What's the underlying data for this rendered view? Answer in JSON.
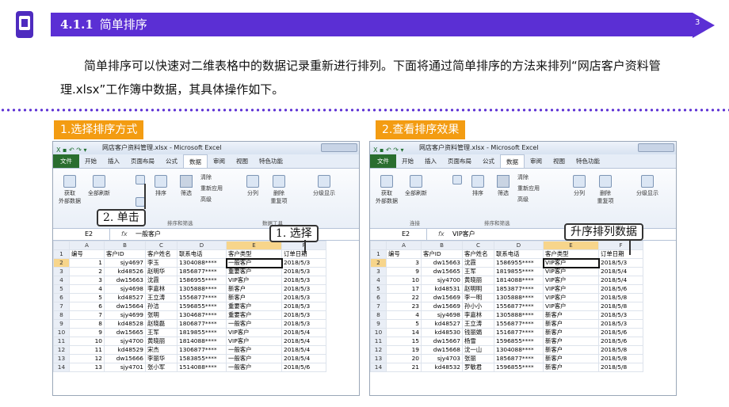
{
  "header": {
    "section_number": "4.1.1",
    "section_title": "简单排序",
    "page_number": "3"
  },
  "intro": "简单排序可以快速对二维表格中的数据记录重新进行排列。下面将通过简单排序的方法来排列“网店客户资料管理.xlsx”工作簿中数据，其具体操作如下。",
  "left": {
    "step_label": "1.选择排序方式",
    "title": "网店客户资料管理.xlsx - Microsoft Excel",
    "tabs": [
      "文件",
      "开始",
      "插入",
      "页面布局",
      "公式",
      "数据",
      "审阅",
      "视图",
      "特色功能"
    ],
    "active_tab": "数据",
    "ribbon": {
      "get_external": "获取\n外部数据",
      "refresh_all": "全部刷新",
      "sort": "排序",
      "filter": "筛选",
      "clear": "清除",
      "reapply": "重新应用",
      "advanced": "高级",
      "split": "分列",
      "remove_dup": "删除\n重复项",
      "outline": "分级显示",
      "group_sort": "排序和筛选",
      "group_tools": "数据工具"
    },
    "namebox": "E2",
    "formula": "一般客户",
    "col_headers": [
      "A",
      "B",
      "C",
      "D",
      "E",
      "F"
    ],
    "rows": [
      [
        "1",
        "编号",
        "客户ID",
        "客户姓名",
        "联系电话",
        "客户类型",
        "订单日期"
      ],
      [
        "2",
        "1",
        "sjy4697",
        "李玉",
        "1304088****",
        "一般客户",
        "2018/5/3"
      ],
      [
        "3",
        "2",
        "kd48526",
        "赵明华",
        "1856877****",
        "重要客户",
        "2018/5/3"
      ],
      [
        "4",
        "3",
        "dw15663",
        "沈霞",
        "1586955****",
        "VIP客户",
        "2018/5/3"
      ],
      [
        "5",
        "4",
        "sjy4698",
        "李嘉林",
        "1305888****",
        "新客户",
        "2018/5/3"
      ],
      [
        "6",
        "5",
        "kd48527",
        "王立涛",
        "1556877****",
        "新客户",
        "2018/5/3"
      ],
      [
        "7",
        "6",
        "dw15664",
        "孙洁",
        "1596855****",
        "重要客户",
        "2018/5/3"
      ],
      [
        "8",
        "7",
        "sjy4699",
        "张明",
        "1304687****",
        "重要客户",
        "2018/5/3"
      ],
      [
        "9",
        "8",
        "kd48528",
        "赵晓磊",
        "1806877****",
        "一般客户",
        "2018/5/3"
      ],
      [
        "10",
        "9",
        "dw15665",
        "王军",
        "1819855****",
        "VIP客户",
        "2018/5/4"
      ],
      [
        "11",
        "10",
        "sjy4700",
        "黄晓丽",
        "1814088****",
        "VIP客户",
        "2018/5/4"
      ],
      [
        "12",
        "11",
        "kd48529",
        "宋杰",
        "1306877****",
        "一般客户",
        "2018/5/4"
      ],
      [
        "13",
        "12",
        "dw15666",
        "李丽华",
        "1583855****",
        "一般客户",
        "2018/5/4"
      ],
      [
        "14",
        "13",
        "sjy4701",
        "张小军",
        "1514088****",
        "一般客户",
        "2018/5/6"
      ]
    ],
    "callouts": {
      "click": "2. 单击",
      "select": "1. 选择"
    }
  },
  "right": {
    "step_label": "2.查看排序效果",
    "title": "网店客户资料管理.xlsx - Microsoft Excel",
    "tabs": [
      "文件",
      "开始",
      "插入",
      "页面布局",
      "公式",
      "数据",
      "审阅",
      "视图",
      "特色功能"
    ],
    "active_tab": "数据",
    "ribbon": {
      "get_external": "获取\n外部数据",
      "refresh_all": "全部刷新",
      "sort": "排序",
      "filter": "筛选",
      "clear": "清除",
      "reapply": "重新应用",
      "advanced": "高级",
      "split": "分列",
      "remove_dup": "删除\n重复项",
      "outline": "分级显示",
      "group_conn": "连接",
      "group_sort": "排序和筛选"
    },
    "namebox": "E2",
    "formula": "VIP客户",
    "col_headers": [
      "A",
      "B",
      "C",
      "D",
      "E",
      "F"
    ],
    "rows": [
      [
        "1",
        "编号",
        "客户ID",
        "客户姓名",
        "联系电话",
        "客户类型",
        "订单日期"
      ],
      [
        "2",
        "3",
        "dw15663",
        "沈霞",
        "1586955****",
        "VIP客户",
        "2018/5/3"
      ],
      [
        "3",
        "9",
        "dw15665",
        "王军",
        "1819855****",
        "VIP客户",
        "2018/5/4"
      ],
      [
        "4",
        "10",
        "sjy4700",
        "黄晓丽",
        "1814088****",
        "VIP客户",
        "2018/5/4"
      ],
      [
        "5",
        "17",
        "kd48531",
        "赵明明",
        "1853877****",
        "VIP客户",
        "2018/5/6"
      ],
      [
        "6",
        "22",
        "dw15669",
        "李一明",
        "1305888****",
        "VIP客户",
        "2018/5/8"
      ],
      [
        "7",
        "23",
        "dw15669",
        "孙小小",
        "1556877****",
        "VIP客户",
        "2018/5/8"
      ],
      [
        "8",
        "4",
        "sjy4698",
        "李嘉林",
        "1305888****",
        "新客户",
        "2018/5/3"
      ],
      [
        "9",
        "5",
        "kd48527",
        "王立涛",
        "1556877****",
        "新客户",
        "2018/5/3"
      ],
      [
        "10",
        "14",
        "kd48530",
        "钱丽娟",
        "1516877****",
        "新客户",
        "2018/5/6"
      ],
      [
        "11",
        "15",
        "dw15667",
        "杨雪",
        "1596855****",
        "新客户",
        "2018/5/6"
      ],
      [
        "12",
        "19",
        "dw15668",
        "沈一山",
        "1304088****",
        "新客户",
        "2018/5/8"
      ],
      [
        "13",
        "20",
        "sjy4703",
        "张丽",
        "1856877****",
        "新客户",
        "2018/5/8"
      ],
      [
        "14",
        "21",
        "kd48532",
        "罗敏君",
        "1596855****",
        "新客户",
        "2018/5/8"
      ]
    ],
    "callouts": {
      "result": "升序排列数据"
    }
  },
  "colors": {
    "accent": "#5b2fd4",
    "step_bg": "#f39c12",
    "excel_green": "#2a6e2f",
    "highlight": "#f7d58b"
  }
}
